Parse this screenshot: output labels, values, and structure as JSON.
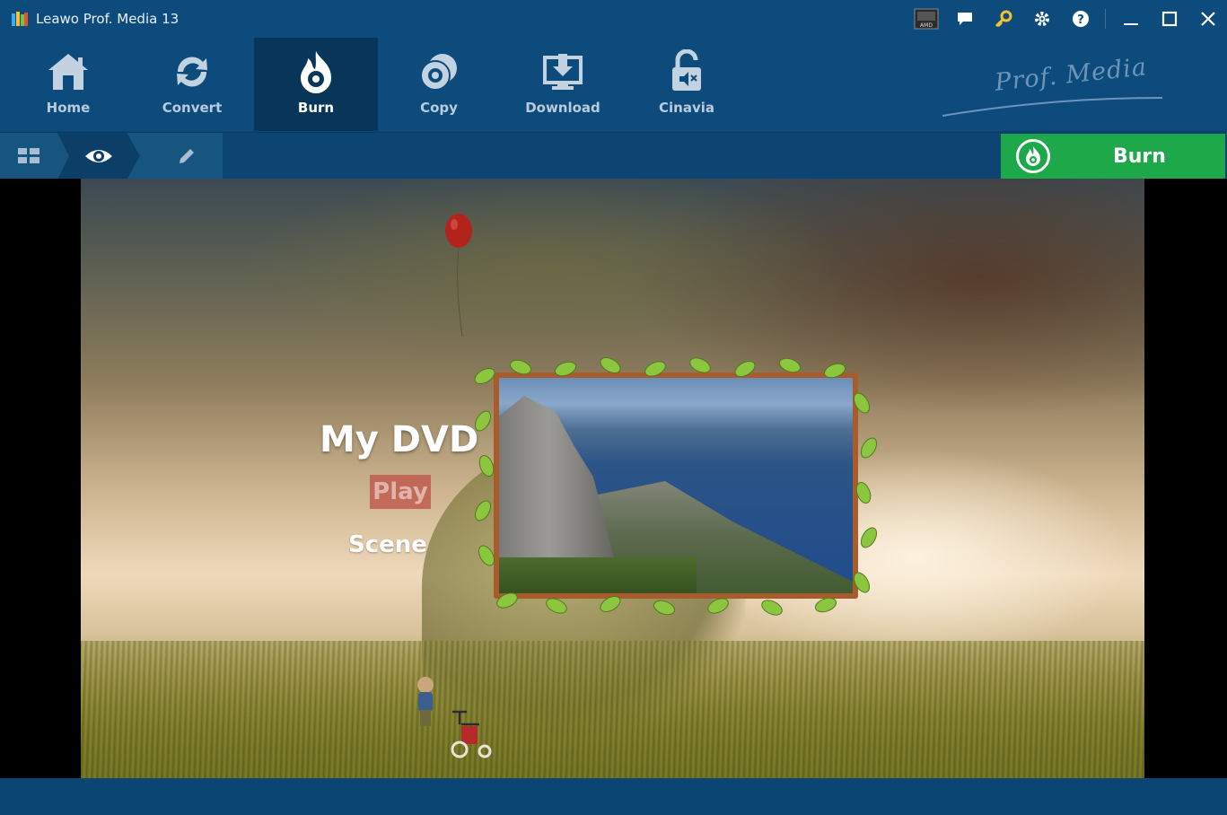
{
  "window": {
    "title": "Leawo Prof. Media 13",
    "controls": [
      "amd-badge-icon",
      "feedback-icon",
      "key-icon",
      "settings-icon",
      "help-icon",
      "minimize-icon",
      "maximize-icon",
      "close-icon"
    ]
  },
  "toolbar": {
    "items": [
      {
        "label": "Home",
        "icon": "home-icon"
      },
      {
        "label": "Convert",
        "icon": "convert-icon"
      },
      {
        "label": "Burn",
        "icon": "burn-icon",
        "active": true
      },
      {
        "label": "Copy",
        "icon": "copy-icon"
      },
      {
        "label": "Download",
        "icon": "download-icon"
      },
      {
        "label": "Cinavia",
        "icon": "cinavia-icon"
      }
    ],
    "brand": "Prof. Media"
  },
  "subbar": {
    "burn_label": "Burn"
  },
  "dvd_menu": {
    "title": "My DVD",
    "play_label": "Play",
    "scene_label": "Scene"
  },
  "colors": {
    "accent": "#1da84a",
    "titlebar": "#0d4b7c",
    "active_tab": "#083558",
    "play_highlight": "#be5046"
  }
}
